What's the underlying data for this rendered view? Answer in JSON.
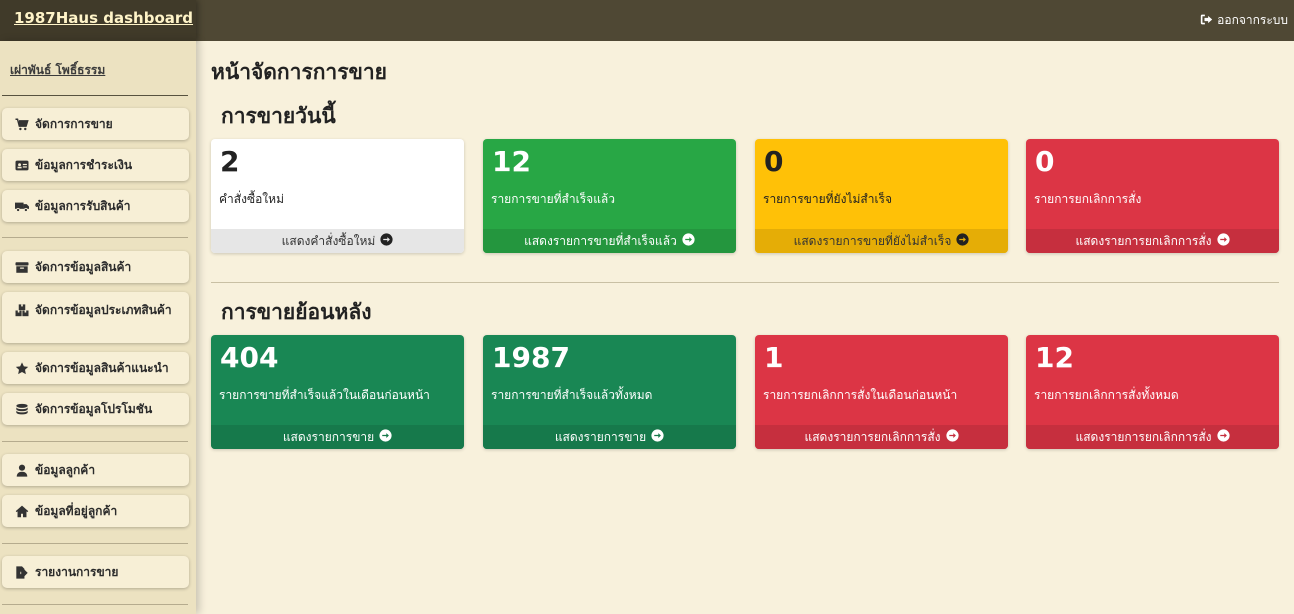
{
  "header": {
    "brand": "1987Haus dashboard",
    "logout_label": "ออกจากระบบ"
  },
  "sidebar": {
    "username": "เผ่าพันธ์ โพธิ์ธรรม",
    "items": [
      {
        "label": "จัดการการขาย",
        "icon": "cart-icon"
      },
      {
        "label": "ข้อมูลการชำระเงิน",
        "icon": "payment-card-icon"
      },
      {
        "label": "ข้อมูลการรับสินค้า",
        "icon": "truck-icon"
      },
      {
        "label": "จัดการข้อมูลสินค้า",
        "icon": "archive-box-icon"
      },
      {
        "label": "จัดการข้อมูลประเภทสินค้า",
        "icon": "boxes-icon"
      },
      {
        "label": "จัดการข้อมูลสินค้าแนะนำ",
        "icon": "star-icon"
      },
      {
        "label": "จัดการข้อมูลโปรโมชัน",
        "icon": "coins-icon"
      },
      {
        "label": "ข้อมูลลูกค้า",
        "icon": "user-icon"
      },
      {
        "label": "ข้อมูลที่อยู่ลูกค้า",
        "icon": "home-icon"
      },
      {
        "label": "รายงานการขาย",
        "icon": "report-export-icon"
      }
    ]
  },
  "main": {
    "page_title": "หน้าจัดการการขาย",
    "today": {
      "title": "การขายวันนี้",
      "cards": [
        {
          "value": "2",
          "label": "คำสั่งซื้อใหม่",
          "link": "แสดงคำสั่งซื้อใหม่",
          "color": "#ffffff"
        },
        {
          "value": "12",
          "label": "รายการขายที่สำเร็จแล้ว",
          "link": "แสดงรายการขายที่สำเร็จแล้ว",
          "color": "#28a745"
        },
        {
          "value": "0",
          "label": "รายการขายที่ยังไม่สำเร็จ",
          "link": "แสดงรายการขายที่ยังไม่สำเร็จ",
          "color": "#ffc107"
        },
        {
          "value": "0",
          "label": "รายการยกเลิกการสั่ง",
          "link": "แสดงรายการยกเลิกการสั่ง",
          "color": "#dc3545"
        }
      ]
    },
    "history": {
      "title": "การขายย้อนหลัง",
      "cards": [
        {
          "value": "404",
          "label": "รายการขายที่สำเร็จแล้วในเดือนก่อนหน้า",
          "link": "แสดงรายการขาย",
          "color": "#198754"
        },
        {
          "value": "1987",
          "label": "รายการขายที่สำเร็จแล้วทั้งหมด",
          "link": "แสดงรายการขาย",
          "color": "#198754"
        },
        {
          "value": "1",
          "label": "รายการยกเลิกการสั่งในเดือนก่อนหน้า",
          "link": "แสดงรายการยกเลิกการสั่ง",
          "color": "#dc3545"
        },
        {
          "value": "12",
          "label": "รายการยกเลิกการสั่งทั้งหมด",
          "link": "แสดงรายการยกเลิกการสั่ง",
          "color": "#dc3545"
        }
      ]
    }
  }
}
